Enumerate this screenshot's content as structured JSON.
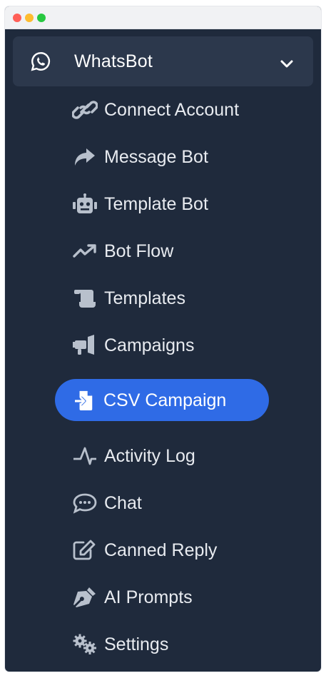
{
  "window": {
    "controls": [
      "close",
      "minimize",
      "maximize"
    ]
  },
  "menu": {
    "parent": {
      "label": "WhatsBot",
      "icon": "whatsapp-icon",
      "expanded": true
    },
    "items": [
      {
        "label": "Connect Account",
        "icon": "link-icon"
      },
      {
        "label": "Message Bot",
        "icon": "share-arrow-icon"
      },
      {
        "label": "Template Bot",
        "icon": "robot-icon"
      },
      {
        "label": "Bot Flow",
        "icon": "trend-up-icon"
      },
      {
        "label": "Templates",
        "icon": "scroll-icon"
      },
      {
        "label": "Campaigns",
        "icon": "megaphone-icon"
      },
      {
        "label": "CSV Campaign",
        "icon": "file-import-icon",
        "active": true
      },
      {
        "label": "Activity Log",
        "icon": "activity-icon"
      },
      {
        "label": "Chat",
        "icon": "chat-bubble-icon"
      },
      {
        "label": "Canned Reply",
        "icon": "edit-square-icon"
      },
      {
        "label": "AI Prompts",
        "icon": "pen-nib-icon"
      },
      {
        "label": "Settings",
        "icon": "gears-icon"
      }
    ]
  },
  "colors": {
    "sidebar_bg": "#1f2a3c",
    "parent_bg": "#2c384c",
    "active_bg": "#2f6be6",
    "icon": "#b8c0cc",
    "text": "#e8ebf0"
  }
}
